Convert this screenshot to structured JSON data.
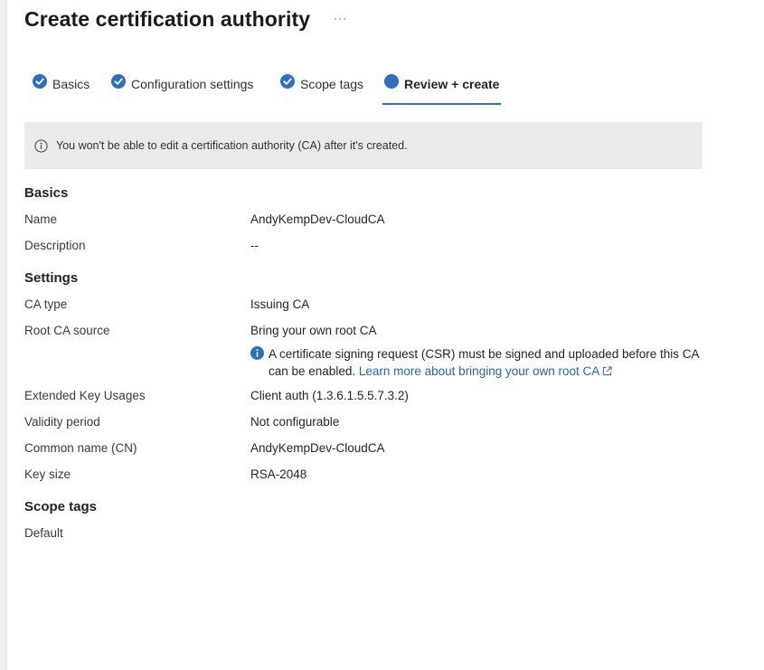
{
  "header": {
    "title": "Create certification authority",
    "more_label": "···"
  },
  "tabs": [
    {
      "label": "Basics",
      "state": "completed"
    },
    {
      "label": "Configuration settings",
      "state": "completed"
    },
    {
      "label": "Scope tags",
      "state": "completed"
    },
    {
      "label": "Review + create",
      "state": "active"
    }
  ],
  "banner": {
    "icon": "info-icon",
    "text": "You won't be able to edit a certification authority (CA) after it's created."
  },
  "basics": {
    "heading": "Basics",
    "name_label": "Name",
    "name_value": "AndyKempDev-CloudCA",
    "description_label": "Description",
    "description_value": "--"
  },
  "settings": {
    "heading": "Settings",
    "ca_type_label": "CA type",
    "ca_type_value": "Issuing CA",
    "root_source_label": "Root CA source",
    "root_source_value": "Bring your own root CA",
    "note_text": "A certificate signing request (CSR) must be signed and uploaded before this CA can be enabled.",
    "note_link": "Learn more about bringing your own root CA",
    "eku_label": "Extended Key Usages",
    "eku_value": "Client auth (1.3.6.1.5.5.7.3.2)",
    "validity_label": "Validity period",
    "validity_value": "Not configurable",
    "cn_label": "Common name (CN)",
    "cn_value": "AndyKempDev-CloudCA",
    "key_size_label": "Key size",
    "key_size_value": "RSA-2048"
  },
  "scope_tags": {
    "heading": "Scope tags",
    "value": "Default"
  },
  "colors": {
    "accent": "#2f6fc0",
    "link": "#1f65c4",
    "banner_bg": "#eaeaea"
  }
}
